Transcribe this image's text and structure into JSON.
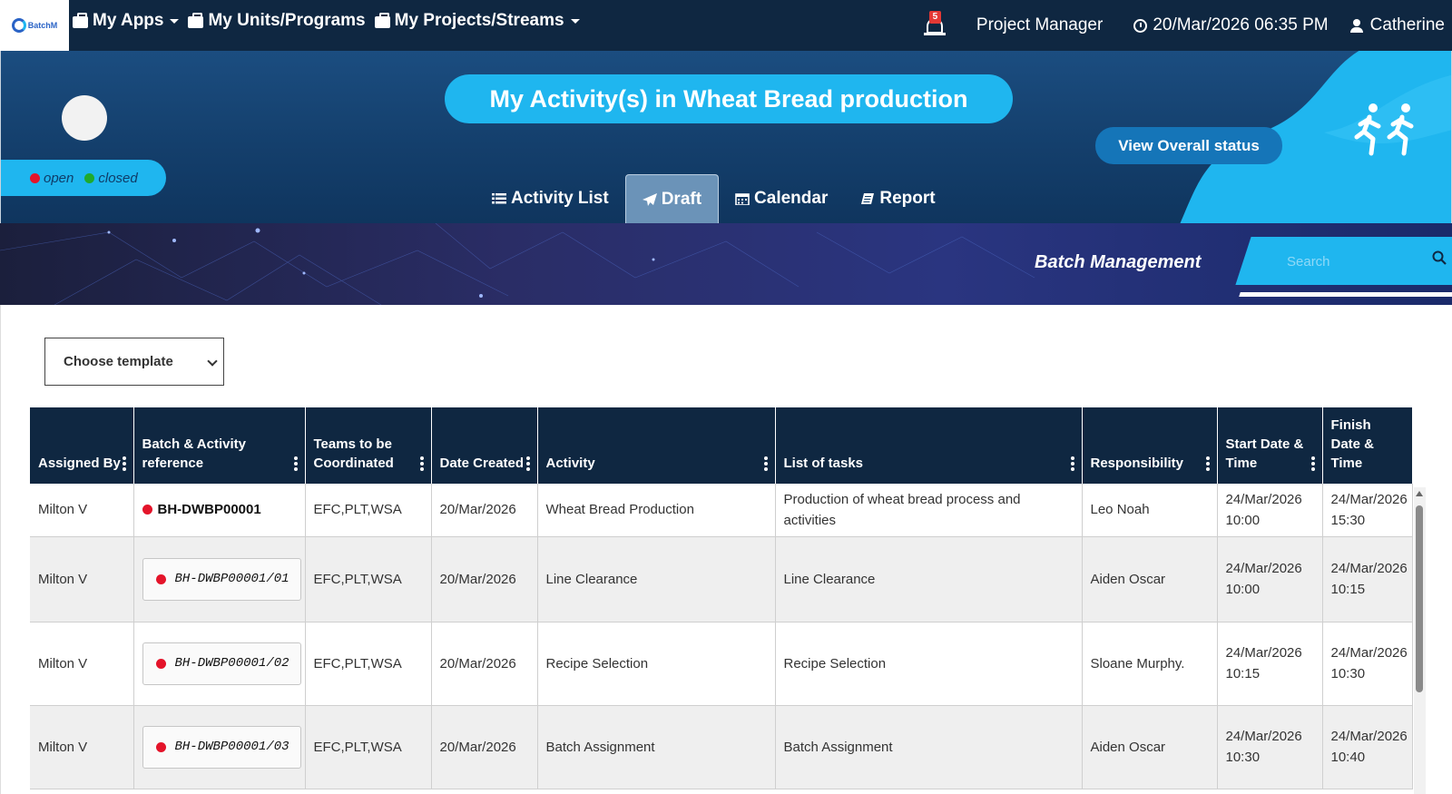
{
  "app": {
    "logo_text": "BatchM",
    "nav": [
      {
        "label": "My Apps",
        "icon": "briefcase-icon"
      },
      {
        "label": "My Units/Programs",
        "icon": "briefcase-icon"
      },
      {
        "label": "My Projects/Streams",
        "icon": "briefcase-icon"
      }
    ],
    "notifications_count": "5",
    "role": "Project Manager",
    "datetime": "20/Mar/2026 06:35 PM",
    "user": "Catherine"
  },
  "hero": {
    "title": "My Activity(s) in Wheat Bread production",
    "overall_button": "View Overall status",
    "legend": {
      "open": "open",
      "closed": "closed",
      "open_color": "#e4142a",
      "closed_color": "#1faa2d"
    },
    "tabs": [
      {
        "label": "Activity List",
        "icon": "list-icon",
        "active": false
      },
      {
        "label": "Draft",
        "icon": "paper-plane-icon",
        "active": true
      },
      {
        "label": "Calendar",
        "icon": "calendar-icon",
        "active": false
      },
      {
        "label": "Report",
        "icon": "report-icon",
        "active": false
      }
    ]
  },
  "banner": {
    "title": "Batch Management",
    "search_placeholder": "Search"
  },
  "template_select": {
    "value": "Choose template"
  },
  "table": {
    "columns": [
      "Assigned By",
      "Batch & Activity reference",
      "Teams to be Coordinated",
      "Date Created",
      "Activity",
      "List of tasks",
      "Responsibility",
      "Start Date & Time",
      "Finish Date & Time"
    ],
    "rows": [
      {
        "assigned_by": "Milton V",
        "reference": "BH-DWBP00001",
        "teams": "EFC,PLT,WSA",
        "date_created": "20/Mar/2026",
        "activity": "Wheat Bread Production",
        "tasks": "Production of wheat bread process and activities",
        "responsibility": "Leo Noah",
        "start": "24/Mar/2026 10:00",
        "finish": "24/Mar/2026 15:30",
        "status": "open"
      },
      {
        "assigned_by": "Milton V",
        "reference": "BH-DWBP00001/01",
        "teams": "EFC,PLT,WSA",
        "date_created": "20/Mar/2026",
        "activity": "Line Clearance",
        "tasks": "Line Clearance",
        "responsibility": "Aiden Oscar",
        "start": "24/Mar/2026 10:00",
        "finish": "24/Mar/2026 10:15",
        "status": "open"
      },
      {
        "assigned_by": "Milton V",
        "reference": "BH-DWBP00001/02",
        "teams": "EFC,PLT,WSA",
        "date_created": "20/Mar/2026",
        "activity": "Recipe Selection",
        "tasks": "Recipe Selection",
        "responsibility": "Sloane Murphy.",
        "start": "24/Mar/2026 10:15",
        "finish": "24/Mar/2026 10:30",
        "status": "open"
      },
      {
        "assigned_by": "Milton V",
        "reference": "BH-DWBP00001/03",
        "teams": "EFC,PLT,WSA",
        "date_created": "20/Mar/2026",
        "activity": "Batch Assignment",
        "tasks": "Batch Assignment",
        "responsibility": "Aiden Oscar",
        "start": "24/Mar/2026 10:30",
        "finish": "24/Mar/2026 10:40",
        "status": "open"
      }
    ]
  }
}
